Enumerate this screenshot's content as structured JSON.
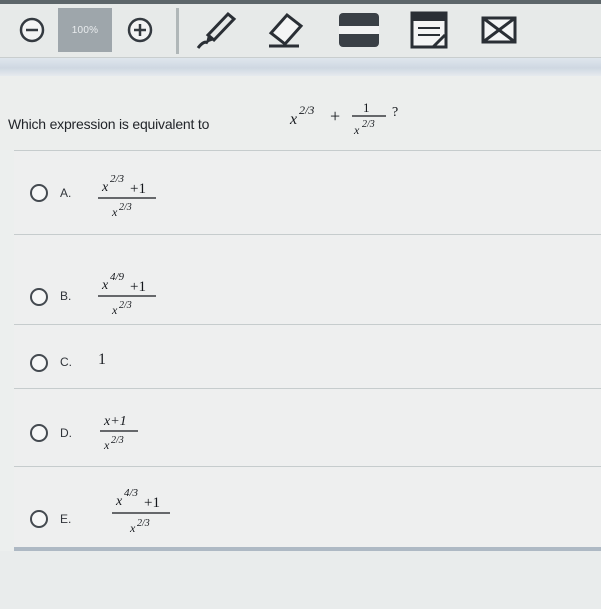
{
  "toolbar": {
    "zoom_level": "100%",
    "tools": [
      "zoom-out-icon",
      "zoom-in-icon",
      "pen-icon",
      "eraser-icon",
      "line-reader-icon",
      "notepad-icon",
      "eliminate-icon"
    ]
  },
  "question": {
    "text": "Which expression is equivalent to",
    "expression": {
      "term1": "x",
      "term1_exp": "2/3",
      "operator": "+",
      "num": "1",
      "den": "x",
      "den_exp": "2/3"
    },
    "end": "?"
  },
  "choices": [
    {
      "letter": "A.",
      "num_base": "x",
      "num_exp": "2/3",
      "num_tail": "+1",
      "den_base": "x",
      "den_exp": "2/3"
    },
    {
      "letter": "B.",
      "num_base": "x",
      "num_exp": "4/9",
      "num_tail": "+1",
      "den_base": "x",
      "den_exp": "2/3"
    },
    {
      "letter": "C.",
      "value": "1"
    },
    {
      "letter": "D.",
      "num_full": "x+1",
      "den_base": "x",
      "den_exp": "2/3"
    },
    {
      "letter": "E.",
      "num_base": "x",
      "num_exp": "4/3",
      "num_tail": "+1",
      "den_base": "x",
      "den_exp": "2/3"
    }
  ],
  "colors": {
    "accent": "#9ea6ab",
    "text": "#1c1f24",
    "band": "#cfd8e2"
  }
}
